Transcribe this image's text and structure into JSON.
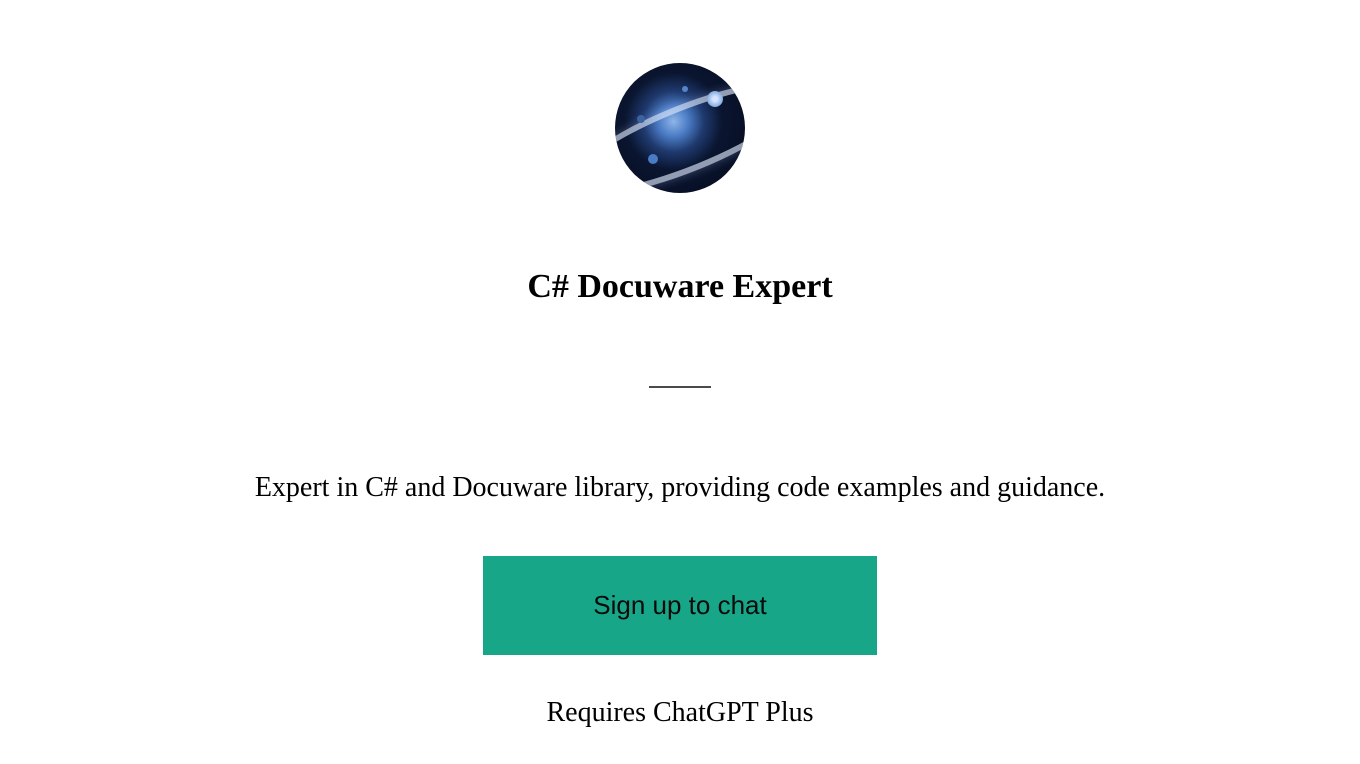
{
  "title": "C# Docuware Expert",
  "description": "Expert in C# and Docuware library, providing code examples and guidance.",
  "signup_button_label": "Sign up to chat",
  "requires_text": "Requires ChatGPT Plus",
  "colors": {
    "button_bg": "#17a788",
    "text": "#000000"
  }
}
